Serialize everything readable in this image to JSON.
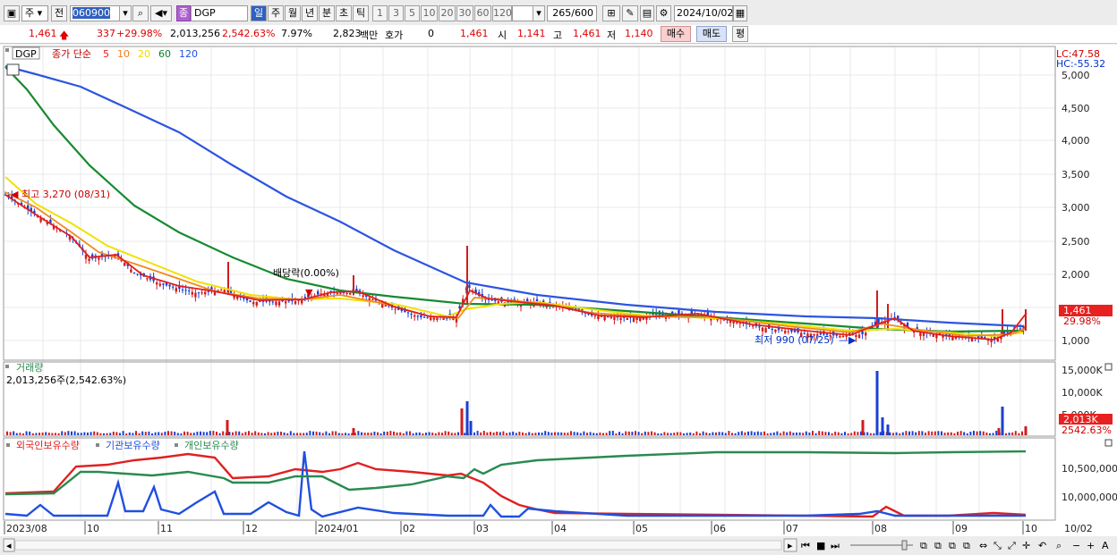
{
  "toolbar": {
    "period_select": "주",
    "prev_label": "전",
    "code_value": "060900",
    "category_badge": "종",
    "stock_name": "DGP",
    "period_tabs": [
      "일",
      "주",
      "월",
      "년",
      "분",
      "초",
      "틱"
    ],
    "active_period": "일",
    "interval_buttons": [
      "1",
      "3",
      "5",
      "10",
      "20",
      "30",
      "60",
      "120"
    ],
    "count_value": "265",
    "count_total": "/600",
    "date_value": "2024/10/02"
  },
  "quote": {
    "price": "1,461",
    "change": "337",
    "change_pct": "+29.98%",
    "volume": "2,013,256",
    "volume_ratio": "2,542.63%",
    "turnover": "7.97%",
    "amount": "2,823",
    "amount_unit": "백만",
    "bid_label": "호가",
    "bid_value": "0",
    "bid_price": "1,461",
    "open_label": "시",
    "open_value": "1,141",
    "high_label": "고",
    "high_value": "1,461",
    "low_label": "저",
    "low_value": "1,140",
    "buy_label": "매수",
    "sell_label": "매도",
    "eval_label": "평"
  },
  "price_panel": {
    "symbol": "DGP",
    "indicator_title": "종가 단순",
    "ma_periods": [
      "5",
      "10",
      "20",
      "60",
      "120"
    ],
    "ma_colors": [
      "#e02020",
      "#f08020",
      "#f0d800",
      "#108030",
      "#2050e0"
    ],
    "lc_label": "LC:47.58",
    "hc_label": "HC:-55.32",
    "y_ticks": [
      "5,000",
      "4,500",
      "4,000",
      "3,500",
      "3,000",
      "2,500",
      "2,000",
      "1,461",
      "1,000"
    ],
    "last_price_tag": "1,461",
    "last_pct_tag": "29.98%",
    "high_annotation": "최고 3,270 (08/31)",
    "low_annotation": "최저 990 (07/25)",
    "dividend_annotation": "배당락(0.00%)"
  },
  "volume_panel": {
    "title": "거래량",
    "summary": "2,013,256주(2,542.63%)",
    "y_ticks": [
      "15,000K",
      "10,000K",
      "5,000K"
    ],
    "last_tag": "2,013K",
    "last_pct": "2542.63%"
  },
  "holder_panel": {
    "legend": [
      "외국인보유수량",
      "기관보유수량",
      "개인보유수량"
    ],
    "legend_colors": [
      "#e02020",
      "#2050e0",
      "#2a8a50"
    ],
    "y_ticks": [
      "10,500,000",
      "10,000,000"
    ]
  },
  "x_axis": [
    "2023/08",
    "10",
    "11",
    "12",
    "2024/01",
    "02",
    "03",
    "04",
    "05",
    "06",
    "07",
    "08",
    "09",
    "10",
    "10/02"
  ]
}
